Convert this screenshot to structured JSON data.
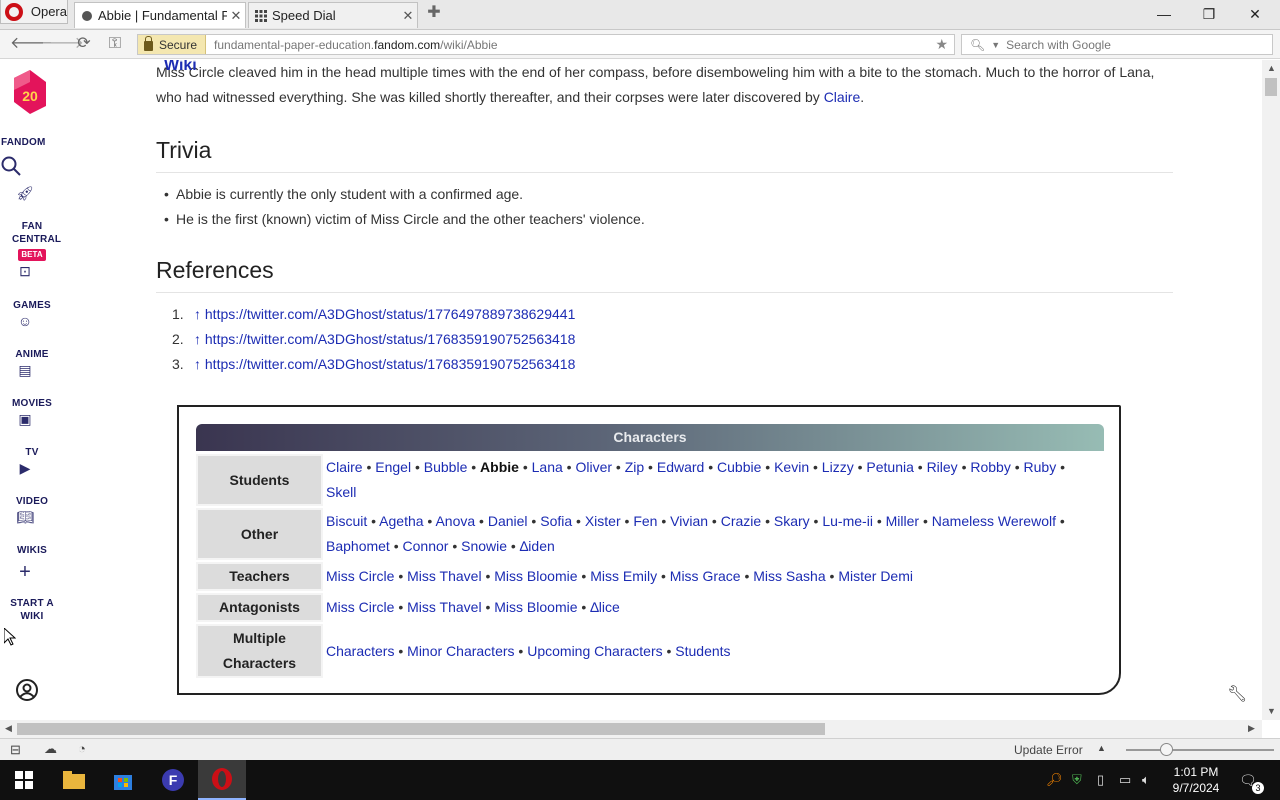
{
  "browser": {
    "menu_label": "Opera",
    "tabs": [
      {
        "title": "Abbie | Fundamental P...",
        "active": true
      },
      {
        "title": "Speed Dial",
        "active": false
      }
    ],
    "secure_label": "Secure",
    "url_prefix": "fundamental-paper-education.",
    "url_domain": "fandom.com",
    "url_path": "/wiki/Abbie",
    "search_placeholder": "Search with Google"
  },
  "rail": {
    "badge_number": "20",
    "items": [
      {
        "label": "FANDOM"
      },
      {
        "label": "FAN CENTRAL"
      },
      {
        "label": "BETA"
      },
      {
        "label": "GAMES"
      },
      {
        "label": "ANIME"
      },
      {
        "label": "MOVIES"
      },
      {
        "label": "TV"
      },
      {
        "label": "VIDEO"
      },
      {
        "label": "WIKIS"
      },
      {
        "label": "START A WIKI"
      }
    ]
  },
  "article": {
    "wiki_overlay": "Wiki",
    "intro_part1": "Miss Circle cleaved him in the head multiple times with the end of her compass, before disemboweling him with a bite to the stomach. Much to the horror of Lana, who had witnessed everything. She was killed shortly thereafter, and their corpses were later discovered by ",
    "intro_link": "Claire",
    "intro_end": ".",
    "trivia_heading": "Trivia",
    "trivia": [
      "Abbie is currently the only student with a confirmed age.",
      "He is the first (known) victim of Miss Circle and the other teachers' violence."
    ],
    "references_heading": "References",
    "references": [
      {
        "num": "1.",
        "arrow": "↑",
        "url": "https://twitter.com/A3DGhost/status/1776497889738629441"
      },
      {
        "num": "2.",
        "arrow": "↑",
        "url": "https://twitter.com/A3DGhost/status/1768359190752563418"
      },
      {
        "num": "3.",
        "arrow": "↑",
        "url": "https://twitter.com/A3DGhost/status/1768359190752563418"
      }
    ]
  },
  "navbox": {
    "title": "Characters",
    "rows": [
      {
        "label": "Students",
        "items": [
          "Claire",
          "Engel",
          "Bubble",
          "Abbie",
          "Lana",
          "Oliver",
          "Zip",
          "Edward",
          "Cubbie",
          "Kevin",
          "Lizzy",
          "Petunia",
          "Riley",
          "Robby",
          "Ruby",
          "Skell"
        ],
        "current": "Abbie"
      },
      {
        "label": "Other",
        "items": [
          "Biscuit",
          "Agetha",
          "Anova",
          "Daniel",
          "Sofia",
          "Xister",
          "Fen",
          "Vivian",
          "Crazie",
          "Skary",
          "Lu-me-ii",
          "Miller",
          "Nameless Werewolf",
          "Baphomet",
          "Connor",
          "Snowie",
          "∆iden"
        ]
      },
      {
        "label": "Teachers",
        "items": [
          "Miss Circle",
          "Miss Thavel",
          "Miss Bloomie",
          "Miss Emily",
          "Miss Grace",
          "Miss Sasha",
          "Mister Demi"
        ]
      },
      {
        "label": "Antagonists",
        "items": [
          "Miss Circle",
          "Miss Thavel",
          "Miss Bloomie",
          "∆lice"
        ]
      },
      {
        "label": "Multiple Characters",
        "items": [
          "Characters",
          "Minor Characters",
          "Upcoming Characters",
          "Students"
        ]
      }
    ]
  },
  "statusbar": {
    "update_label": "Update Error"
  },
  "taskbar": {
    "time": "1:01 PM",
    "date": "9/7/2024",
    "notification_count": "3"
  }
}
